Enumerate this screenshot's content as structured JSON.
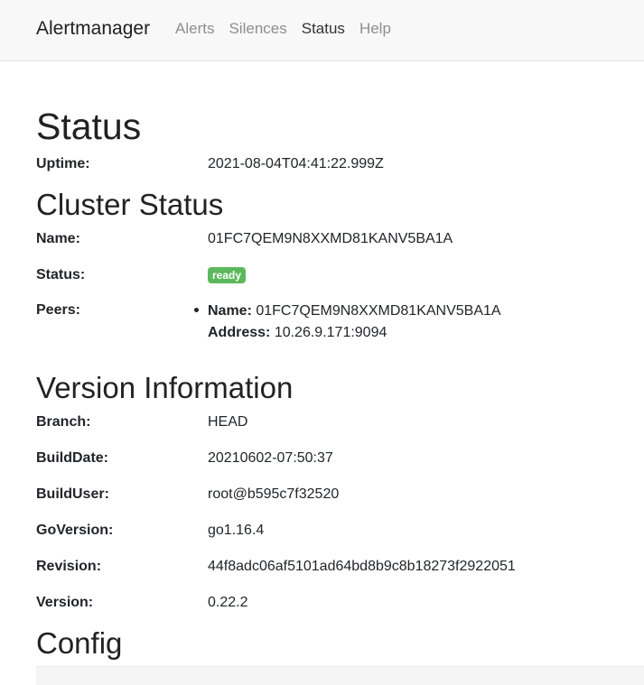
{
  "nav": {
    "brand": "Alertmanager",
    "links": [
      {
        "label": "Alerts",
        "active": false
      },
      {
        "label": "Silences",
        "active": false
      },
      {
        "label": "Status",
        "active": true
      },
      {
        "label": "Help",
        "active": false
      }
    ]
  },
  "status": {
    "title": "Status",
    "uptime_label": "Uptime:",
    "uptime_value": "2021-08-04T04:41:22.999Z"
  },
  "cluster": {
    "title": "Cluster Status",
    "name_label": "Name:",
    "name_value": "01FC7QEM9N8XXMD81KANV5BA1A",
    "status_label": "Status:",
    "status_badge": "ready",
    "status_badge_color": "#5cb85c",
    "peers_label": "Peers:",
    "peers": [
      {
        "name_label": "Name:",
        "name": "01FC7QEM9N8XXMD81KANV5BA1A",
        "address_label": "Address:",
        "address": "10.26.9.171:9094"
      }
    ]
  },
  "version": {
    "title": "Version Information",
    "rows": [
      {
        "label": "Branch:",
        "value": "HEAD"
      },
      {
        "label": "BuildDate:",
        "value": "20210602-07:50:37"
      },
      {
        "label": "BuildUser:",
        "value": "root@b595c7f32520"
      },
      {
        "label": "GoVersion:",
        "value": "go1.16.4"
      },
      {
        "label": "Revision:",
        "value": "44f8adc06af5101ad64bd8b9c8b18273f2922051"
      },
      {
        "label": "Version:",
        "value": "0.22.2"
      }
    ]
  },
  "config": {
    "title": "Config"
  }
}
